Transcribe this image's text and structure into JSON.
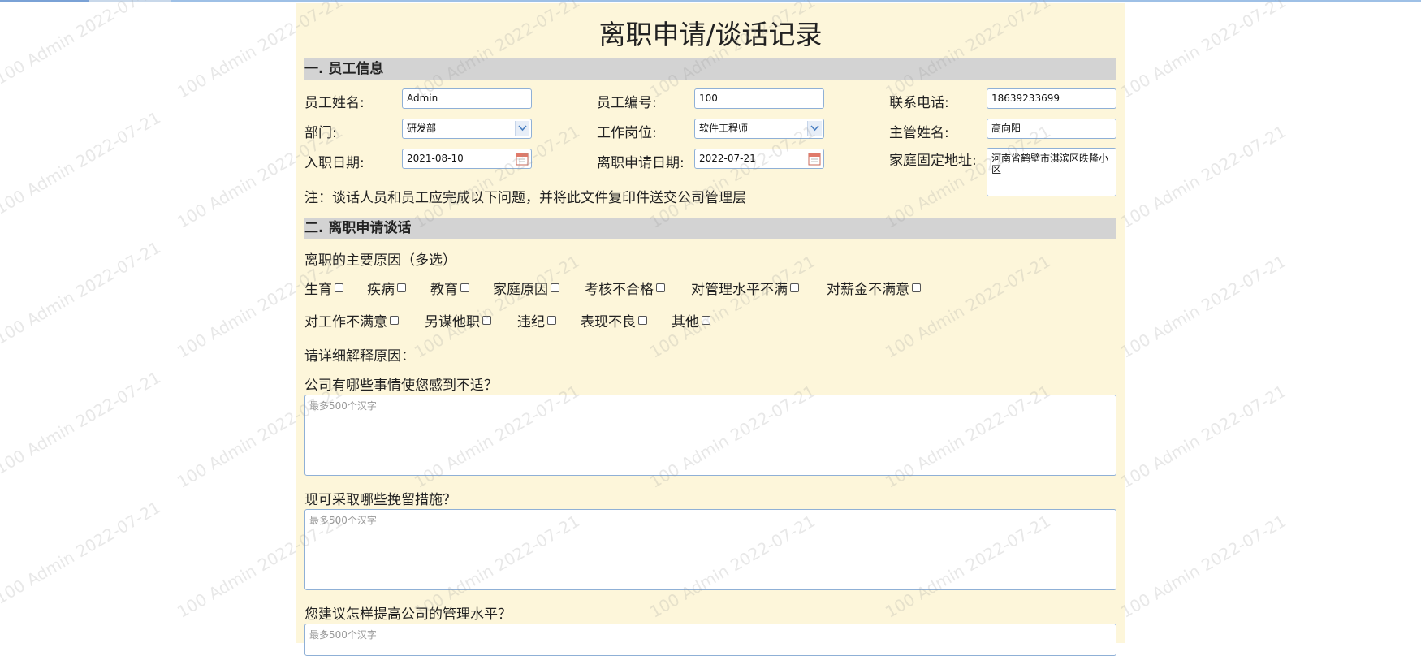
{
  "title": "离职申请/谈话记录",
  "section1": {
    "heading": "一. 员工信息",
    "name_label": "员工姓名:",
    "name_value": "Admin",
    "id_label": "员工编号:",
    "id_value": "100",
    "phone_label": "联系电话:",
    "phone_value": "18639233699",
    "dept_label": "部门:",
    "dept_value": "研发部",
    "position_label": "工作岗位:",
    "position_value": "软件工程师",
    "manager_label": "主管姓名:",
    "manager_value": "高向阳",
    "hire_label": "入职日期:",
    "hire_value": "2021-08-10",
    "apply_label": "离职申请日期:",
    "apply_value": "2022-07-21",
    "address_label": "家庭固定地址:",
    "address_value": "河南省鹤壁市淇滨区昳隆小区",
    "note": "注：谈话人员和员工应完成以下问题，并将此文件复印件送交公司管理层"
  },
  "section2": {
    "heading": "二. 离职申请谈话",
    "reasons_title": "离职的主要原因（多选）",
    "reasons_row1": [
      "生育",
      "疾病",
      "教育",
      "家庭原因",
      "考核不合格",
      "对管理水平不满",
      "对薪金不满意"
    ],
    "reasons_row2": [
      "对工作不满意",
      "另谋他职",
      "违纪",
      "表现不良",
      "其他"
    ],
    "explain_label": "请详细解释原因：",
    "q1": "公司有哪些事情使您感到不适？",
    "q1_placeholder": "最多500个汉字",
    "q2": "现可采取哪些挽留措施？",
    "q2_placeholder": "最多500个汉字",
    "q3": "您建议怎样提高公司的管理水平？",
    "q3_placeholder": "最多500个汉字"
  },
  "watermark": "100 Admin 2022-07-21"
}
